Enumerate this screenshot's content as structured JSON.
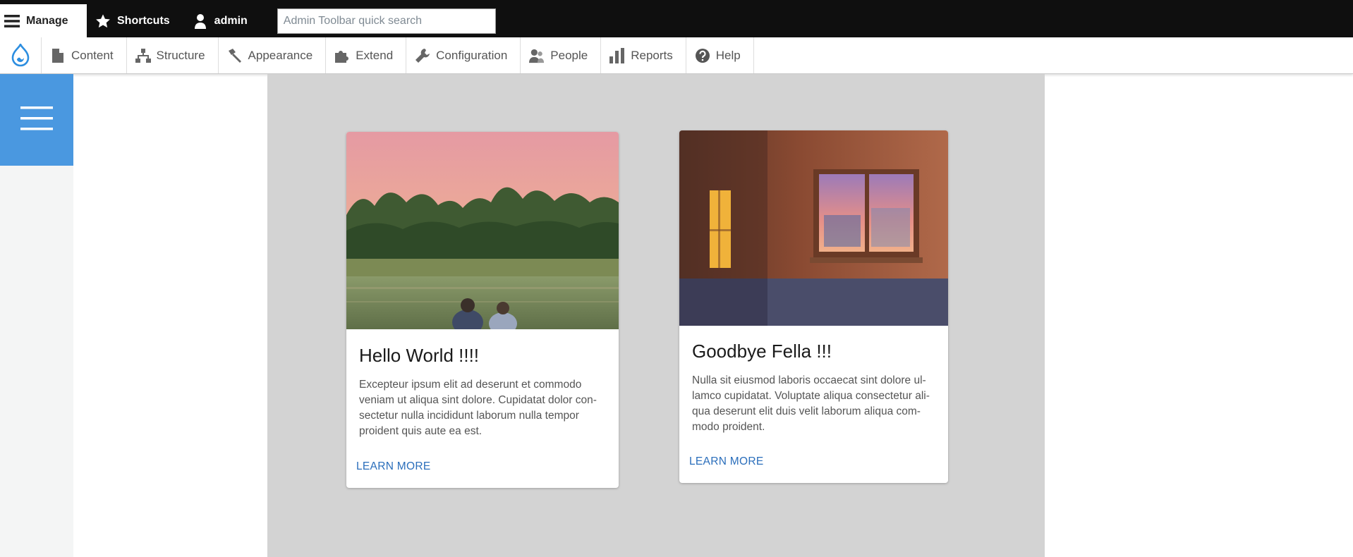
{
  "toolbar": {
    "manage_label": "Manage",
    "shortcuts_label": "Shortcuts",
    "user_label": "admin",
    "search_placeholder": "Admin Toolbar quick search"
  },
  "tray": {
    "items": [
      {
        "label": "Content",
        "icon": "document-icon"
      },
      {
        "label": "Structure",
        "icon": "sitemap-icon"
      },
      {
        "label": "Appearance",
        "icon": "paintbrush-icon"
      },
      {
        "label": "Extend",
        "icon": "puzzle-icon"
      },
      {
        "label": "Configuration",
        "icon": "wrench-icon"
      },
      {
        "label": "People",
        "icon": "people-icon"
      },
      {
        "label": "Reports",
        "icon": "bar-chart-icon"
      },
      {
        "label": "Help",
        "icon": "question-icon"
      }
    ]
  },
  "cards": [
    {
      "title": "Hello World !!!!",
      "body": "Excepteur ipsum elit ad deserunt et commodo veniam ut aliqua sint dolore. Cupidatat dolor con-sectetur nulla incididunt laborum nulla tempor proident quis aute ea est.",
      "link": "LEARN MORE"
    },
    {
      "title": "Goodbye Fella !!!",
      "body": "Nulla sit eiusmod laboris occaecat sint dolore ul-lamco cupidatat. Voluptate aliqua consectetur ali-qua deserunt elit duis velit laborum aliqua com-modo proident.",
      "link": "LEARN MORE"
    }
  ],
  "colors": {
    "toolbar_bg": "#0f0f0f",
    "menu_button": "#4a98e0",
    "main_bg": "#d3d3d3",
    "link": "#2a6ebb",
    "drupal_logo": "#2d8ee0"
  }
}
